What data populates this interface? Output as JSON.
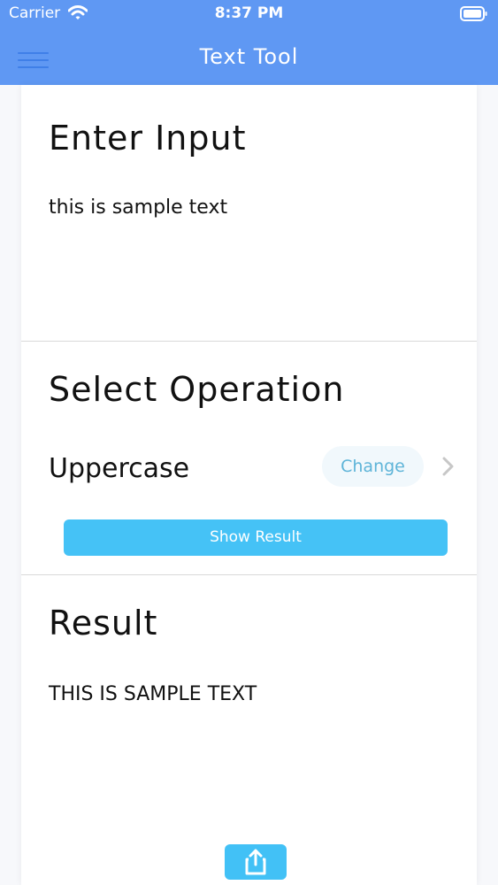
{
  "status_bar": {
    "carrier": "Carrier",
    "time": "8:37 PM",
    "icons": [
      "wifi-icon",
      "battery-icon"
    ]
  },
  "nav": {
    "title": "Text Tool",
    "menu_icon": "hamburger-menu-icon"
  },
  "input_section": {
    "title": "Enter Input",
    "value": "this is sample text"
  },
  "operation_section": {
    "title": "Select Operation",
    "selected_operation": "Uppercase",
    "change_label": "Change",
    "chevron_icon": "chevron-right-icon",
    "show_result_label": "Show Result"
  },
  "result_section": {
    "title": "Result",
    "value": "THIS IS SAMPLE TEXT",
    "share_icon": "share-icon"
  },
  "colors": {
    "header_background": "#5f98f3",
    "menu_icon": "#3f7fe8",
    "button_accent": "#45c2f6",
    "change_button_background": "#f1f8fc",
    "change_button_text": "#5eb4d8"
  }
}
